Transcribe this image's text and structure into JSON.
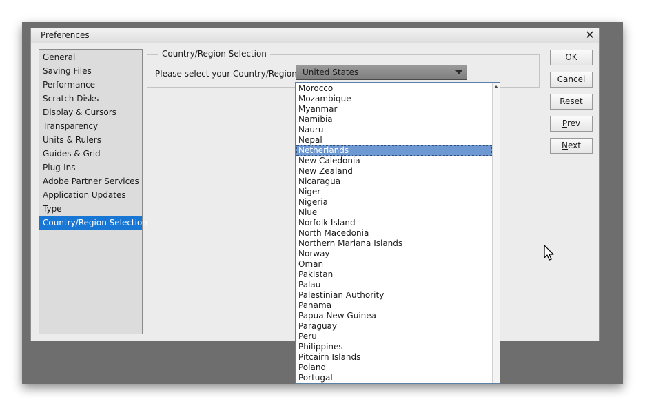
{
  "dialog": {
    "title": "Preferences",
    "close_label": "✕"
  },
  "sidebar": {
    "items": [
      {
        "label": "General"
      },
      {
        "label": "Saving Files"
      },
      {
        "label": "Performance"
      },
      {
        "label": "Scratch Disks"
      },
      {
        "label": "Display & Cursors"
      },
      {
        "label": "Transparency"
      },
      {
        "label": "Units & Rulers"
      },
      {
        "label": "Guides & Grid"
      },
      {
        "label": "Plug-Ins"
      },
      {
        "label": "Adobe Partner Services"
      },
      {
        "label": "Application Updates"
      },
      {
        "label": "Type"
      },
      {
        "label": "Country/Region Selection"
      }
    ],
    "active_index": 12
  },
  "section": {
    "legend": "Country/Region Selection",
    "prompt": "Please select your Country/Region:",
    "selected_value": "United States"
  },
  "buttons": {
    "ok": "OK",
    "cancel": "Cancel",
    "reset": "Reset",
    "prev": "Prev",
    "next": "Next"
  },
  "dropdown": {
    "highlighted": "Netherlands",
    "options": [
      "Morocco",
      "Mozambique",
      "Myanmar",
      "Namibia",
      "Nauru",
      "Nepal",
      "Netherlands",
      "New Caledonia",
      "New Zealand",
      "Nicaragua",
      "Niger",
      "Nigeria",
      "Niue",
      "Norfolk Island",
      "North Macedonia",
      "Northern Mariana Islands",
      "Norway",
      "Oman",
      "Pakistan",
      "Palau",
      "Palestinian Authority",
      "Panama",
      "Papua New Guinea",
      "Paraguay",
      "Peru",
      "Philippines",
      "Pitcairn Islands",
      "Poland",
      "Portugal"
    ]
  },
  "icons": {
    "close": "close-icon",
    "dropdown_arrow": "chevron-down-icon",
    "scroll_up": "scroll-up-arrow-icon",
    "pointer": "mouse-pointer-icon"
  }
}
